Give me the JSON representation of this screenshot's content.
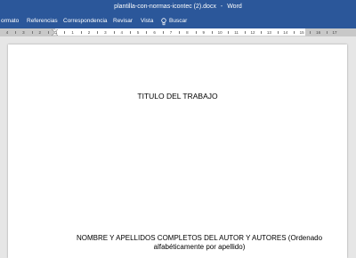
{
  "window": {
    "doc_name": "plantilla-con-normas-icontec (2).docx",
    "separator": "-",
    "app_name": "Word"
  },
  "ribbon": {
    "tabs": [
      {
        "label": "ormato"
      },
      {
        "label": "Referencias"
      },
      {
        "label": "Correspondencia"
      },
      {
        "label": "Revisar"
      },
      {
        "label": "Vista"
      }
    ],
    "tell_me_label": "Buscar"
  },
  "ruler": {
    "numbers": [
      "4",
      "3",
      "2",
      "1",
      "1",
      "2",
      "3",
      "4",
      "5",
      "6",
      "7",
      "8",
      "9",
      "10",
      "11",
      "12",
      "13",
      "14",
      "15",
      "16",
      "17"
    ]
  },
  "document": {
    "title": "TITULO DEL TRABAJO",
    "authors_text": "NOMBRE Y APELLIDOS COMPLETOS DEL AUTOR Y AUTORES (Ordenado alfabéticamente por apellido)"
  },
  "colors": {
    "word_blue": "#2b579a",
    "canvas_gray": "#e6e6e6"
  }
}
